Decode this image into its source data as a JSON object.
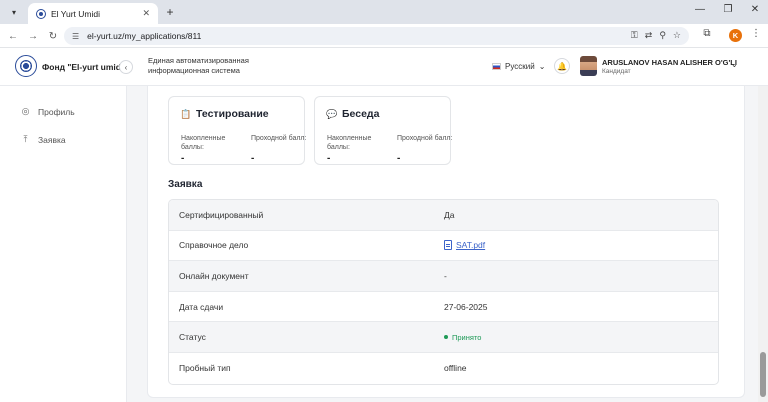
{
  "browser": {
    "tab_title": "El Yurt Umidi",
    "tab_close": "✕",
    "new_tab": "+",
    "url": "el-yurt.uz/my_applications/811"
  },
  "header": {
    "brand": "Фонд \"El-yurt umidi\"",
    "system_name": "Единая автоматизированная информационная система",
    "language": "Русский",
    "user_name": "ARUSLANOV HASAN ALISHER O'G'LI",
    "user_role": "Кандидат",
    "profile_initial": "K"
  },
  "sidebar": {
    "items": [
      {
        "label": "Профиль",
        "icon": "user-circle-icon"
      },
      {
        "label": "Заявка",
        "icon": "upload-icon"
      }
    ]
  },
  "scores": [
    {
      "title": "Тестирование",
      "icon": "clipboard-icon",
      "accumulated_label": "Накопленные баллы:",
      "passing_label": "Проходной балл:",
      "accumulated_value": "-",
      "passing_value": "-"
    },
    {
      "title": "Беседа",
      "icon": "chat-icon",
      "accumulated_label": "Накопленные баллы:",
      "passing_label": "Проходной балл:",
      "accumulated_value": "-",
      "passing_value": "-"
    }
  ],
  "application": {
    "section_title": "Заявка",
    "rows": [
      {
        "label": "Сертифицированный",
        "value": "Да"
      },
      {
        "label": "Справочное дело",
        "value": "SAT.pdf"
      },
      {
        "label": "Онлайн документ",
        "value": "-"
      },
      {
        "label": "Дата сдачи",
        "value": "27-06-2025"
      },
      {
        "label": "Статус",
        "value": "Принято"
      },
      {
        "label": "Пробный тип",
        "value": "offline"
      }
    ]
  },
  "colors": {
    "accent": "#2c5fd7",
    "status_success": "#1e9a57",
    "link": "#3b63c9"
  }
}
